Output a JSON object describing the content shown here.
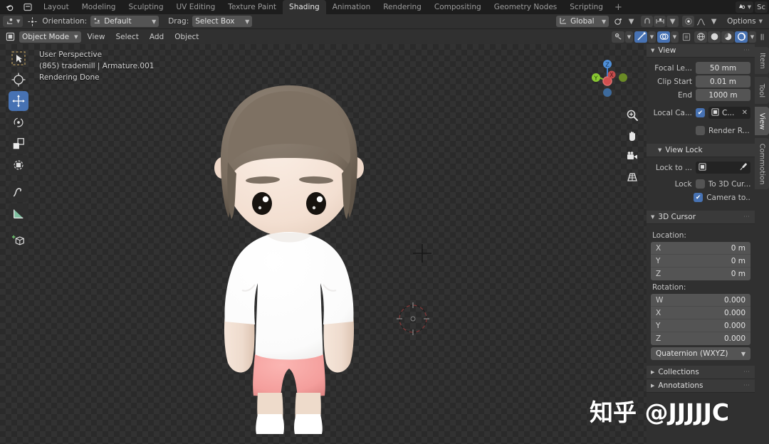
{
  "topbar": {
    "app_icon": "blender-logo-icon",
    "menu_icons": [
      "editor-menu-icon"
    ],
    "workspace_tabs": [
      {
        "label": "Layout",
        "active": false
      },
      {
        "label": "Modeling",
        "active": false
      },
      {
        "label": "Sculpting",
        "active": false
      },
      {
        "label": "UV Editing",
        "active": false
      },
      {
        "label": "Texture Paint",
        "active": false
      },
      {
        "label": "Shading",
        "active": true
      },
      {
        "label": "Animation",
        "active": false
      },
      {
        "label": "Rendering",
        "active": false
      },
      {
        "label": "Compositing",
        "active": false
      },
      {
        "label": "Geometry Nodes",
        "active": false
      },
      {
        "label": "Scripting",
        "active": false
      }
    ],
    "add_workspace_label": "+",
    "scene_chip_label": "",
    "view_layer_chip_label": "Sc"
  },
  "tool_settings": {
    "active_tool_label": "",
    "transform_label": "",
    "orientation_label": "Orientation:",
    "orientation_value": "Default",
    "drag_label": "Drag:",
    "drag_value": "Select Box",
    "global_value": "Global",
    "snap_value": "",
    "proportional_value": "",
    "options_label": "Options"
  },
  "viewport_header": {
    "mode_label": "Object Mode",
    "menus": [
      "View",
      "Select",
      "Add",
      "Object"
    ],
    "shading_modes": [
      "wireframe",
      "solid",
      "material-preview",
      "rendered"
    ],
    "active_shading": "rendered"
  },
  "viewport": {
    "overlay_lines": [
      "User Perspective",
      "(865) trademill | Armature.001",
      "Rendering Done"
    ],
    "gizmo_axes": [
      "Z",
      "X",
      "Y"
    ],
    "nav_buttons": [
      "zoom-icon",
      "pan-hand-icon",
      "camera-view-icon",
      "toggle-perspective-icon"
    ],
    "left_tools": [
      {
        "name": "tweak-select-tool",
        "active": false
      },
      {
        "name": "cursor-tool",
        "active": false
      },
      {
        "name": "move-tool",
        "active": true
      },
      {
        "name": "rotate-tool",
        "active": false
      },
      {
        "name": "scale-tool",
        "active": false
      },
      {
        "name": "transform-tool",
        "active": false
      },
      {
        "name": "annotate-tool",
        "active": false
      },
      {
        "name": "measure-tool",
        "active": false
      },
      {
        "name": "add-cube-tool",
        "active": false
      }
    ]
  },
  "sidebar": {
    "tabs": [
      {
        "label": "Item",
        "active": false
      },
      {
        "label": "Tool",
        "active": false
      },
      {
        "label": "View",
        "active": true
      },
      {
        "label": "Commotion",
        "active": false
      }
    ],
    "view_panel": {
      "title": "View",
      "focal_label": "Focal Le...",
      "focal_value": "50 mm",
      "clip_start_label": "Clip Start",
      "clip_start_value": "0.01 m",
      "clip_end_label": "End",
      "clip_end_value": "1000 m",
      "local_camera_label": "Local Ca...",
      "local_camera_checked": true,
      "local_camera_value": "C...",
      "render_region_label": "Render R...",
      "render_region_checked": false
    },
    "view_lock_panel": {
      "title": "View Lock",
      "lock_to_label": "Lock to ...",
      "lock_to_value": "",
      "lock_label": "Lock",
      "to_3d_cursor_label": "To 3D Cur...",
      "to_3d_cursor_checked": false,
      "camera_to_label": "Camera to...",
      "camera_to_checked": true
    },
    "cursor_panel": {
      "title": "3D Cursor",
      "location_label": "Location:",
      "location": [
        {
          "axis": "X",
          "value": "0 m"
        },
        {
          "axis": "Y",
          "value": "0 m"
        },
        {
          "axis": "Z",
          "value": "0 m"
        }
      ],
      "rotation_label": "Rotation:",
      "rotation": [
        {
          "axis": "W",
          "value": "0.000"
        },
        {
          "axis": "X",
          "value": "0.000"
        },
        {
          "axis": "Y",
          "value": "0.000"
        },
        {
          "axis": "Z",
          "value": "0.000"
        }
      ],
      "rotation_mode": "Quaternion (WXYZ)"
    },
    "collections_panel": {
      "title": "Collections"
    },
    "annotations_panel": {
      "title": "Annotations"
    }
  },
  "watermark": {
    "text": "知乎 @JJJJJC"
  },
  "colors": {
    "accent_blue": "#4772b3",
    "panel_bg": "#303030",
    "field_bg": "#545454",
    "topbar_bg": "#1d1d1d",
    "viewport_dark": "#2a2a2a",
    "viewport_light": "#323232",
    "hair": "#7d7062",
    "skin": "#f2ded2",
    "shirt": "#fdfdfd",
    "shorts": "#f4a2a0"
  }
}
